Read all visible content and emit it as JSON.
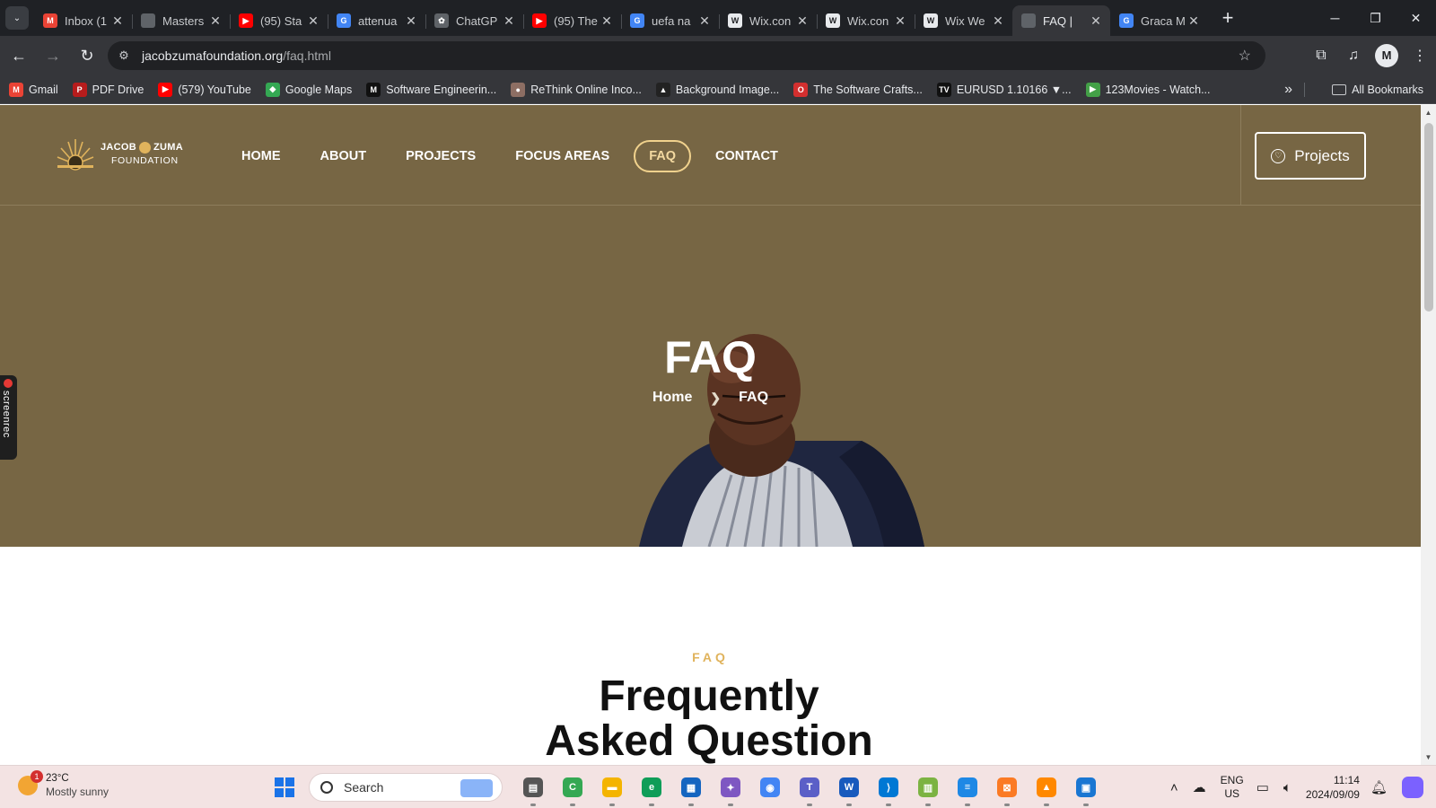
{
  "browser": {
    "tabs": [
      {
        "title": "Inbox (1",
        "icon": "gmail-icon",
        "color": "#ea4335",
        "glyph": "M"
      },
      {
        "title": "Masters",
        "icon": "globe-icon",
        "color": "#5f6368",
        "glyph": ""
      },
      {
        "title": "(95) Sta",
        "icon": "youtube-icon",
        "color": "#ff0000",
        "glyph": "▶"
      },
      {
        "title": "attenua",
        "icon": "google-icon",
        "color": "#4285f4",
        "glyph": "G"
      },
      {
        "title": "ChatGP",
        "icon": "chatgpt-icon",
        "color": "#5f6368",
        "glyph": "✿"
      },
      {
        "title": "(95) The",
        "icon": "youtube-icon",
        "color": "#ff0000",
        "glyph": "▶"
      },
      {
        "title": "uefa na",
        "icon": "google-icon",
        "color": "#4285f4",
        "glyph": "G"
      },
      {
        "title": "Wix.con",
        "icon": "wix-icon",
        "color": "#e8eaed",
        "glyph": "W"
      },
      {
        "title": "Wix.con",
        "icon": "wix-icon",
        "color": "#e8eaed",
        "glyph": "W"
      },
      {
        "title": "Wix We",
        "icon": "wix-icon",
        "color": "#e8eaed",
        "glyph": "W"
      },
      {
        "title": "FAQ |",
        "icon": "globe-icon",
        "color": "#5f6368",
        "glyph": "",
        "active": true
      },
      {
        "title": "Graca M",
        "icon": "google-icon",
        "color": "#4285f4",
        "glyph": "G"
      }
    ],
    "url_host": "jacobzumafoundation.org",
    "url_path": "/faq.html",
    "bookmarks": [
      {
        "label": "Gmail",
        "icon": "gmail-icon",
        "color": "#ea4335",
        "glyph": "M"
      },
      {
        "label": "PDF Drive",
        "icon": "pdf-drive-icon",
        "color": "#b71c1c",
        "glyph": "P"
      },
      {
        "label": "(579) YouTube",
        "icon": "youtube-icon",
        "color": "#ff0000",
        "glyph": "▶"
      },
      {
        "label": "Google Maps",
        "icon": "google-maps-icon",
        "color": "#34a853",
        "glyph": "◆"
      },
      {
        "label": "Software Engineerin...",
        "icon": "medium-icon",
        "color": "#111111",
        "glyph": "M"
      },
      {
        "label": "ReThink Online Inco...",
        "icon": "rethink-icon",
        "color": "#8d6e63",
        "glyph": "●"
      },
      {
        "label": "Background Image...",
        "icon": "background-image-icon",
        "color": "#222222",
        "glyph": "▲"
      },
      {
        "label": "The Software Crafts...",
        "icon": "software-crafts-icon",
        "color": "#d32f2f",
        "glyph": "O"
      },
      {
        "label": "EURUSD 1.10166 ▼...",
        "icon": "tradingview-icon",
        "color": "#111111",
        "glyph": "TV"
      },
      {
        "label": "123Movies - Watch...",
        "icon": "play-icon",
        "color": "#43a047",
        "glyph": "▶"
      }
    ],
    "all_bookmarks_label": "All Bookmarks"
  },
  "site": {
    "logo": {
      "name_left": "JACOB",
      "name_right": "ZUMA",
      "sub": "FOUNDATION"
    },
    "nav": [
      "HOME",
      "ABOUT",
      "PROJECTS",
      "FOCUS AREAS",
      "FAQ",
      "CONTACT"
    ],
    "active_nav": "FAQ",
    "cta_label": "Projects",
    "hero_title": "FAQ",
    "breadcrumb": {
      "home": "Home",
      "current": "FAQ"
    },
    "faq_eyebrow": "FAQ",
    "faq_heading": "Frequently Asked Question",
    "colors": {
      "header_bg": "#776644",
      "accent": "#e0b35c"
    }
  },
  "overlay": {
    "screenrec_label": "screenrec"
  },
  "taskbar": {
    "weather_temp": "23°C",
    "weather_desc": "Mostly sunny",
    "weather_badge": "1",
    "search_placeholder": "Search",
    "apps": [
      {
        "name": "file-manager-icon",
        "color": "#555555",
        "glyph": "▤"
      },
      {
        "name": "chrome-color-icon",
        "color": "#34a853",
        "glyph": "C"
      },
      {
        "name": "file-explorer-icon",
        "color": "#f4b400",
        "glyph": "▬"
      },
      {
        "name": "edge-icon",
        "color": "#0f9d58",
        "glyph": "e"
      },
      {
        "name": "microsoft-store-icon",
        "color": "#1565c0",
        "glyph": "▦"
      },
      {
        "name": "copilot-app-icon",
        "color": "#7e57c2",
        "glyph": "✦"
      },
      {
        "name": "chrome-icon",
        "color": "#4285f4",
        "glyph": "◉",
        "current": true
      },
      {
        "name": "teams-icon",
        "color": "#5b5fc7",
        "glyph": "T"
      },
      {
        "name": "word-icon",
        "color": "#185abd",
        "glyph": "W"
      },
      {
        "name": "vscode-icon",
        "color": "#0078d4",
        "glyph": "⟩"
      },
      {
        "name": "spreadsheet-icon",
        "color": "#7cb342",
        "glyph": "▥"
      },
      {
        "name": "notepad-icon",
        "color": "#1e88e5",
        "glyph": "≡"
      },
      {
        "name": "xampp-icon",
        "color": "#fb7a24",
        "glyph": "⊠"
      },
      {
        "name": "vlc-icon",
        "color": "#ff8800",
        "glyph": "▲"
      },
      {
        "name": "photos-icon",
        "color": "#1976d2",
        "glyph": "▣"
      }
    ],
    "lang_top": "ENG",
    "lang_bottom": "US",
    "time": "11:14",
    "date": "2024/09/09"
  }
}
